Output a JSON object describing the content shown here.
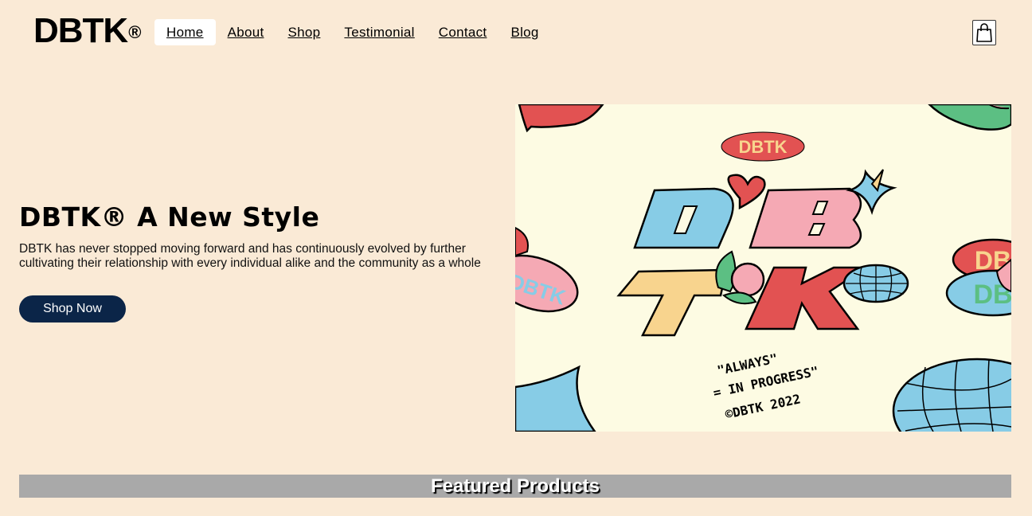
{
  "header": {
    "logo_text": "DBTK",
    "logo_mark": "®",
    "nav": [
      {
        "label": "Home",
        "active": true
      },
      {
        "label": "About",
        "active": false
      },
      {
        "label": "Shop",
        "active": false
      },
      {
        "label": "Testimonial",
        "active": false
      },
      {
        "label": "Contact",
        "active": false
      },
      {
        "label": "Blog",
        "active": false
      }
    ],
    "cart_icon": "shopping-bag-icon"
  },
  "hero": {
    "title": "DBTK® A New Style",
    "description": "DBTK has never stopped moving forward and has continuously evolved by further cultivating their relationship with every individual alike and the community as a whole",
    "cta_label": "Shop Now",
    "image_texts": {
      "badge": "DBTK",
      "letters": [
        "D",
        "B",
        "T",
        "K"
      ],
      "script_line1": "\"ALWAYS\"",
      "script_line2": "= IN PROGRESS\"",
      "script_line3": "©DBTK 2022",
      "side_badge_left": "DBTK",
      "side_badge_right_top": "DB",
      "side_badge_right_bottom": "DB"
    }
  },
  "featured": {
    "title": "Featured Products"
  },
  "colors": {
    "background": "#faead6",
    "button": "#0b2548",
    "featured_bar": "#a9a9a9"
  }
}
